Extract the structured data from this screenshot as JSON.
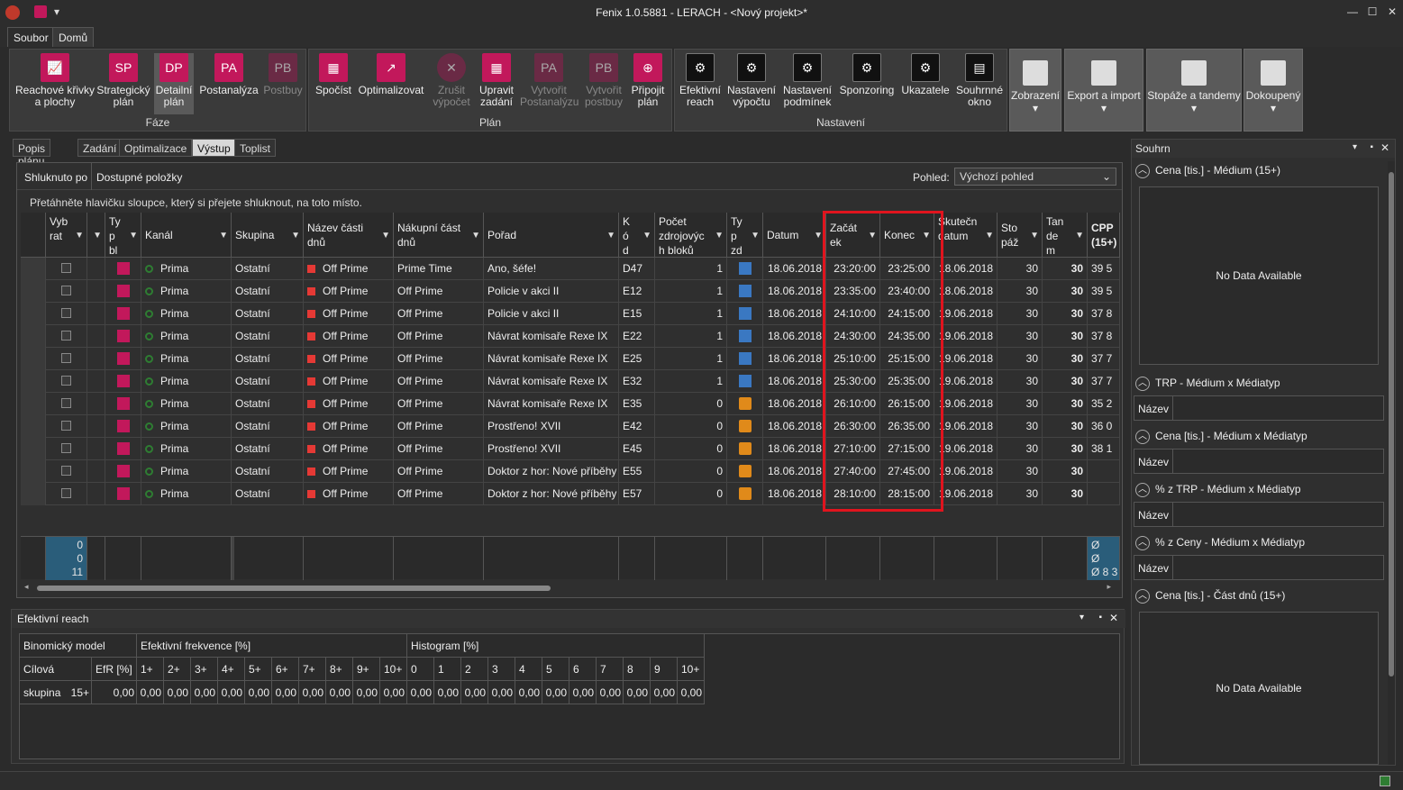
{
  "window": {
    "title": "Fenix 1.0.5881 - LERACH - <Nový projekt>*"
  },
  "menu_tabs": [
    "Soubor",
    "Domů"
  ],
  "ribbon": {
    "groups": {
      "faze": "Fáze",
      "plan": "Plán",
      "nastaveni": "Nastavení"
    },
    "faze_buttons": [
      {
        "icon": "chart-icon",
        "label": "Reachové křivky a plochy"
      },
      {
        "icon": "SP",
        "label": "Strategický plán"
      },
      {
        "icon": "DP",
        "label": "Detailní plán"
      },
      {
        "icon": "PA",
        "label": "Postanalýza"
      },
      {
        "icon": "PB",
        "label": "Postbuy"
      }
    ],
    "plan_buttons": [
      {
        "icon": "calculator-icon",
        "label": "Spočíst"
      },
      {
        "icon": "optimize-icon",
        "label": "Optimalizovat"
      },
      {
        "icon": "cancel-icon",
        "label": "Zrušit výpočet"
      },
      {
        "icon": "edit-table-icon",
        "label": "Upravit zadání"
      },
      {
        "icon": "PA",
        "label": "Vytvořit Postanalýzu"
      },
      {
        "icon": "PB",
        "label": "Vytvořit postbuy"
      },
      {
        "icon": "attach-plan-icon",
        "label": "Připojit plán"
      }
    ],
    "nastaveni_buttons": [
      {
        "icon": "gear-icon",
        "label": "Efektivní reach"
      },
      {
        "icon": "gear-icon",
        "label": "Nastavení výpočtu"
      },
      {
        "icon": "gear-icon",
        "label": "Nastavení podmínek"
      },
      {
        "icon": "gear-icon",
        "label": "Sponzoring"
      },
      {
        "icon": "gear-icon",
        "label": "Ukazatele"
      },
      {
        "icon": "window-icon",
        "label": "Souhrnné okno"
      }
    ],
    "right_buttons": [
      "Zobrazení",
      "Export a import",
      "Stopáže a tandemy",
      "Dokoupený"
    ]
  },
  "doc_tabs": [
    "Popis plánu",
    "Zadání",
    "Optimalizace",
    "Výstup",
    "Toplist"
  ],
  "groupbar": {
    "shluknuto": "Shluknuto po",
    "dostupne": "Dostupné položky",
    "pohled_label": "Pohled:",
    "pohled_value": "Výchozí pohled"
  },
  "hint": "Přetáhněte hlavičku sloupce, který si přejete shluknout, na toto místo.",
  "columns": [
    "Vyb rat",
    "",
    "Ty p bl",
    "Kanál",
    "Skupina",
    "Název části dnů",
    "Nákupní část dnů",
    "Pořad",
    "K ó d",
    "Počet zdrojovýc h bloků",
    "Ty p zd",
    "Datum",
    "Začát ek",
    "Konec",
    "Skutečn datum",
    "Sto páž",
    "Tan de m",
    "CPP (15+)"
  ],
  "rows": [
    {
      "kanal": "Prima",
      "skupina": "Ostatní",
      "nazev": "Off Prime",
      "nakup": "Prime Time",
      "porad": "Ano, šéfe!",
      "kod": "D47",
      "pocet": "1",
      "typ": "blue",
      "datum": "18.06.2018",
      "zacatek": "23:20:00",
      "konec": "23:25:00",
      "skut": "18.06.2018",
      "stopaz": "30",
      "tandem": "30",
      "cpp": "39 5"
    },
    {
      "kanal": "Prima",
      "skupina": "Ostatní",
      "nazev": "Off Prime",
      "nakup": "Off Prime",
      "porad": "Policie v akci II",
      "kod": "E12",
      "pocet": "1",
      "typ": "blue",
      "datum": "18.06.2018",
      "zacatek": "23:35:00",
      "konec": "23:40:00",
      "skut": "18.06.2018",
      "stopaz": "30",
      "tandem": "30",
      "cpp": "39 5"
    },
    {
      "kanal": "Prima",
      "skupina": "Ostatní",
      "nazev": "Off Prime",
      "nakup": "Off Prime",
      "porad": "Policie v akci II",
      "kod": "E15",
      "pocet": "1",
      "typ": "blue",
      "datum": "18.06.2018",
      "zacatek": "24:10:00",
      "konec": "24:15:00",
      "skut": "19.06.2018",
      "stopaz": "30",
      "tandem": "30",
      "cpp": "37 8"
    },
    {
      "kanal": "Prima",
      "skupina": "Ostatní",
      "nazev": "Off Prime",
      "nakup": "Off Prime",
      "porad": "Návrat komisaře Rexe IX",
      "kod": "E22",
      "pocet": "1",
      "typ": "blue",
      "datum": "18.06.2018",
      "zacatek": "24:30:00",
      "konec": "24:35:00",
      "skut": "19.06.2018",
      "stopaz": "30",
      "tandem": "30",
      "cpp": "37 8"
    },
    {
      "kanal": "Prima",
      "skupina": "Ostatní",
      "nazev": "Off Prime",
      "nakup": "Off Prime",
      "porad": "Návrat komisaře Rexe IX",
      "kod": "E25",
      "pocet": "1",
      "typ": "blue",
      "datum": "18.06.2018",
      "zacatek": "25:10:00",
      "konec": "25:15:00",
      "skut": "19.06.2018",
      "stopaz": "30",
      "tandem": "30",
      "cpp": "37 7"
    },
    {
      "kanal": "Prima",
      "skupina": "Ostatní",
      "nazev": "Off Prime",
      "nakup": "Off Prime",
      "porad": "Návrat komisaře Rexe IX",
      "kod": "E32",
      "pocet": "1",
      "typ": "blue",
      "datum": "18.06.2018",
      "zacatek": "25:30:00",
      "konec": "25:35:00",
      "skut": "19.06.2018",
      "stopaz": "30",
      "tandem": "30",
      "cpp": "37 7"
    },
    {
      "kanal": "Prima",
      "skupina": "Ostatní",
      "nazev": "Off Prime",
      "nakup": "Off Prime",
      "porad": "Návrat komisaře Rexe IX",
      "kod": "E35",
      "pocet": "0",
      "typ": "orange",
      "datum": "18.06.2018",
      "zacatek": "26:10:00",
      "konec": "26:15:00",
      "skut": "19.06.2018",
      "stopaz": "30",
      "tandem": "30",
      "cpp": "35 2"
    },
    {
      "kanal": "Prima",
      "skupina": "Ostatní",
      "nazev": "Off Prime",
      "nakup": "Off Prime",
      "porad": "Prostřeno! XVII",
      "kod": "E42",
      "pocet": "0",
      "typ": "orange",
      "datum": "18.06.2018",
      "zacatek": "26:30:00",
      "konec": "26:35:00",
      "skut": "19.06.2018",
      "stopaz": "30",
      "tandem": "30",
      "cpp": "36 0"
    },
    {
      "kanal": "Prima",
      "skupina": "Ostatní",
      "nazev": "Off Prime",
      "nakup": "Off Prime",
      "porad": "Prostřeno! XVII",
      "kod": "E45",
      "pocet": "0",
      "typ": "orange",
      "datum": "18.06.2018",
      "zacatek": "27:10:00",
      "konec": "27:15:00",
      "skut": "19.06.2018",
      "stopaz": "30",
      "tandem": "30",
      "cpp": "38 1"
    },
    {
      "kanal": "Prima",
      "skupina": "Ostatní",
      "nazev": "Off Prime",
      "nakup": "Off Prime",
      "porad": "Doktor z hor: Nové příběhy",
      "kod": "E55",
      "pocet": "0",
      "typ": "orange",
      "datum": "18.06.2018",
      "zacatek": "27:40:00",
      "konec": "27:45:00",
      "skut": "19.06.2018",
      "stopaz": "30",
      "tandem": "30",
      "cpp": ""
    },
    {
      "kanal": "Prima",
      "skupina": "Ostatní",
      "nazev": "Off Prime",
      "nakup": "Off Prime",
      "porad": "Doktor z hor: Nové příběhy",
      "kod": "E57",
      "pocet": "0",
      "typ": "orange",
      "datum": "18.06.2018",
      "zacatek": "28:10:00",
      "konec": "28:15:00",
      "skut": "19.06.2018",
      "stopaz": "30",
      "tandem": "30",
      "cpp": ""
    }
  ],
  "footer": {
    "v1": "0",
    "v2": "0",
    "v3": "11",
    "cpp1": "Ø",
    "cpp2": "Ø",
    "cpp3": "Ø 8 3"
  },
  "reach": {
    "title": "Efektivní reach",
    "h_model": "Binomický model",
    "h_frekvence": "Efektivní frekvence [%]",
    "h_histogram": "Histogram [%]",
    "cols": [
      "Cílová skupina",
      "EfR [%]",
      "1+",
      "2+",
      "3+",
      "4+",
      "5+",
      "6+",
      "7+",
      "8+",
      "9+",
      "10+",
      "0",
      "1",
      "2",
      "3",
      "4",
      "5",
      "6",
      "7",
      "8",
      "9",
      "10+"
    ],
    "vals": [
      "15+",
      "0,00",
      "0,00",
      "0,00",
      "0,00",
      "0,00",
      "0,00",
      "0,00",
      "0,00",
      "0,00",
      "0,00",
      "0,00",
      "0,00",
      "0,00",
      "0,00",
      "0,00",
      "0,00",
      "0,00",
      "0,00",
      "0,00",
      "0,00",
      "0,00",
      "0,00"
    ]
  },
  "souhrn": {
    "title": "Souhrn",
    "s1": "Cena [tis.] - Médium (15+)",
    "nodata": "No Data Available",
    "s2": "TRP - Médium x Médiatyp",
    "s3": "Cena [tis.] - Médium x Médiatyp",
    "s4": "% z TRP - Médium x Médiatyp",
    "s5": "% z Ceny - Médium x Médiatyp",
    "s6": "Cena [tis.] - Část dnů (15+)",
    "nazev": "Název"
  }
}
